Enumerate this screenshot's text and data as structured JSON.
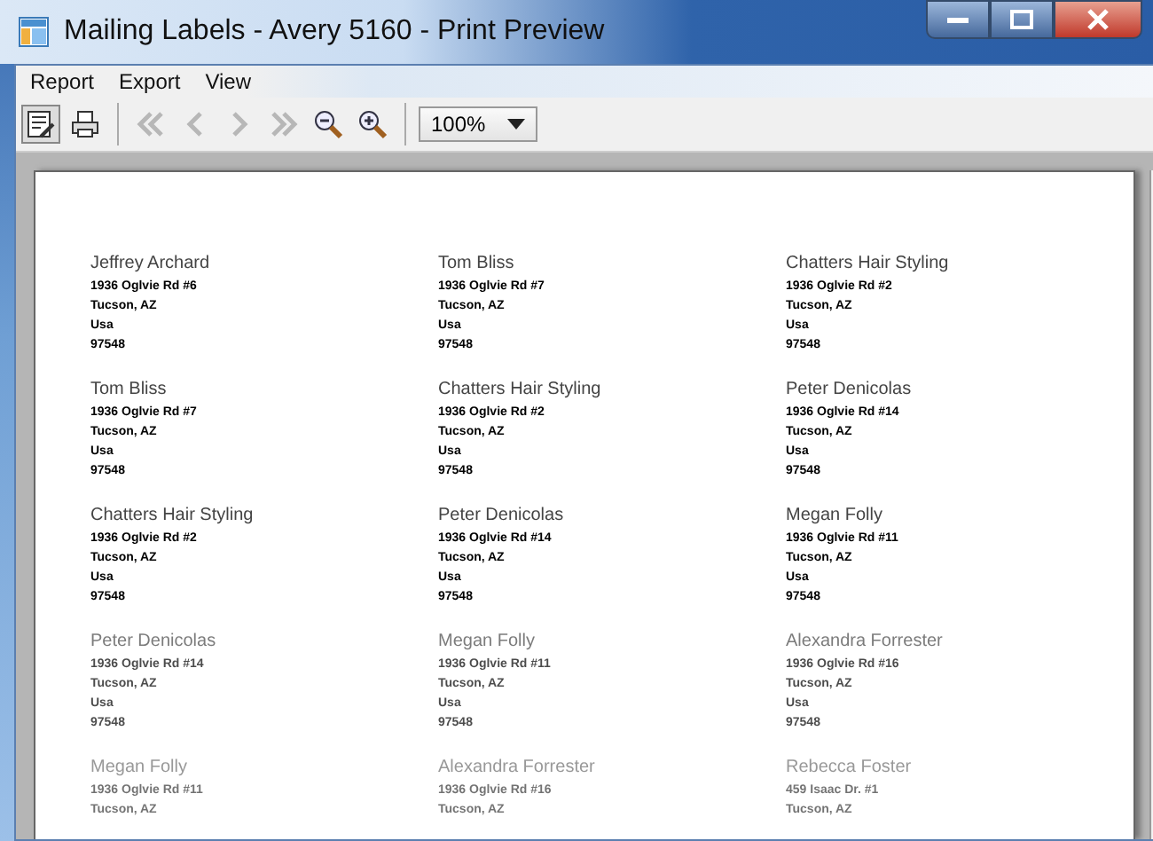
{
  "window": {
    "title": "Mailing Labels - Avery 5160 - Print Preview"
  },
  "menu": [
    "Report",
    "Export",
    "View"
  ],
  "toolbar": {
    "buttons": [
      {
        "kind": "page-setup",
        "pressed": true,
        "disabled": false
      },
      {
        "kind": "print",
        "pressed": false,
        "disabled": false
      },
      {
        "kind": "first",
        "pressed": false,
        "disabled": true
      },
      {
        "kind": "prev",
        "pressed": false,
        "disabled": true
      },
      {
        "kind": "next",
        "pressed": false,
        "disabled": true
      },
      {
        "kind": "last",
        "pressed": false,
        "disabled": true
      },
      {
        "kind": "zoom-out",
        "pressed": false,
        "disabled": false
      },
      {
        "kind": "zoom-in",
        "pressed": false,
        "disabled": false
      }
    ],
    "zoom": "100%"
  },
  "labels": [
    [
      {
        "name": "Jeffrey Archard",
        "lines": [
          "1936 Oglvie Rd #6",
          "Tucson, AZ",
          "Usa",
          "97548"
        ]
      },
      {
        "name": "Tom Bliss",
        "lines": [
          "1936 Oglvie Rd #7",
          "Tucson, AZ",
          "Usa",
          "97548"
        ]
      },
      {
        "name": "Chatters Hair Styling",
        "lines": [
          "1936 Oglvie Rd #2",
          "Tucson, AZ",
          "Usa",
          "97548"
        ]
      }
    ],
    [
      {
        "name": "Tom Bliss",
        "lines": [
          "1936 Oglvie Rd #7",
          "Tucson, AZ",
          "Usa",
          "97548"
        ]
      },
      {
        "name": "Chatters Hair Styling",
        "lines": [
          "1936 Oglvie Rd #2",
          "Tucson, AZ",
          "Usa",
          "97548"
        ]
      },
      {
        "name": "Peter Denicolas",
        "lines": [
          "1936 Oglvie Rd #14",
          "Tucson, AZ",
          "Usa",
          "97548"
        ]
      }
    ],
    [
      {
        "name": "Chatters Hair Styling",
        "lines": [
          "1936 Oglvie Rd #2",
          "Tucson, AZ",
          "Usa",
          "97548"
        ]
      },
      {
        "name": "Peter Denicolas",
        "lines": [
          "1936 Oglvie Rd #14",
          "Tucson, AZ",
          "Usa",
          "97548"
        ]
      },
      {
        "name": "Megan Folly",
        "lines": [
          "1936 Oglvie Rd #11",
          "Tucson, AZ",
          "Usa",
          "97548"
        ]
      }
    ],
    [
      {
        "name": "Peter Denicolas",
        "lines": [
          "1936 Oglvie Rd #14",
          "Tucson, AZ",
          "Usa",
          "97548"
        ]
      },
      {
        "name": "Megan Folly",
        "lines": [
          "1936 Oglvie Rd #11",
          "Tucson, AZ",
          "Usa",
          "97548"
        ]
      },
      {
        "name": "Alexandra Forrester",
        "lines": [
          "1936 Oglvie Rd #16",
          "Tucson, AZ",
          "Usa",
          "97548"
        ]
      }
    ],
    [
      {
        "name": "Megan Folly",
        "lines": [
          "1936 Oglvie Rd #11",
          "Tucson, AZ"
        ]
      },
      {
        "name": "Alexandra Forrester",
        "lines": [
          "1936 Oglvie Rd #16",
          "Tucson, AZ"
        ]
      },
      {
        "name": "Rebecca Foster",
        "lines": [
          "459 Isaac Dr. #1",
          "Tucson, AZ"
        ]
      }
    ]
  ]
}
